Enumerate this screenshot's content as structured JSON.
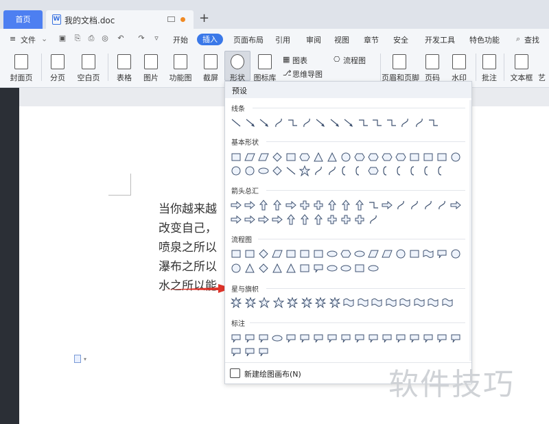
{
  "tabs": {
    "home": "首页",
    "doc_title": "我的文档.doc",
    "add": "+"
  },
  "menu": {
    "file": "文件",
    "items": [
      "开始",
      "插入",
      "页面布局",
      "引用",
      "审阅",
      "视图",
      "章节",
      "安全",
      "开发工具",
      "特色功能",
      "查找"
    ],
    "active": "插入"
  },
  "ribbon": {
    "buttons": [
      "封面页",
      "分页",
      "空白页",
      "表格",
      "图片",
      "功能图",
      "截屏",
      "形状",
      "图标库",
      "图表",
      "思维导图",
      "流程图",
      "页眉和页脚",
      "页码",
      "水印",
      "批注",
      "文本框",
      "艺"
    ]
  },
  "document": {
    "lines": [
      "当你越来越",
      "改变自己，",
      "喷泉之所以",
      "瀑布之所以",
      "水之所以能"
    ]
  },
  "panel": {
    "preset": "预设",
    "sections": [
      "线条",
      "基本形状",
      "箭头总汇",
      "流程图",
      "星与旗帜",
      "标注"
    ],
    "footer": "新建绘图画布(N)"
  },
  "watermark": "软件技巧",
  "colors": {
    "accent": "#3a78e8",
    "arrow": "#e0342a"
  }
}
